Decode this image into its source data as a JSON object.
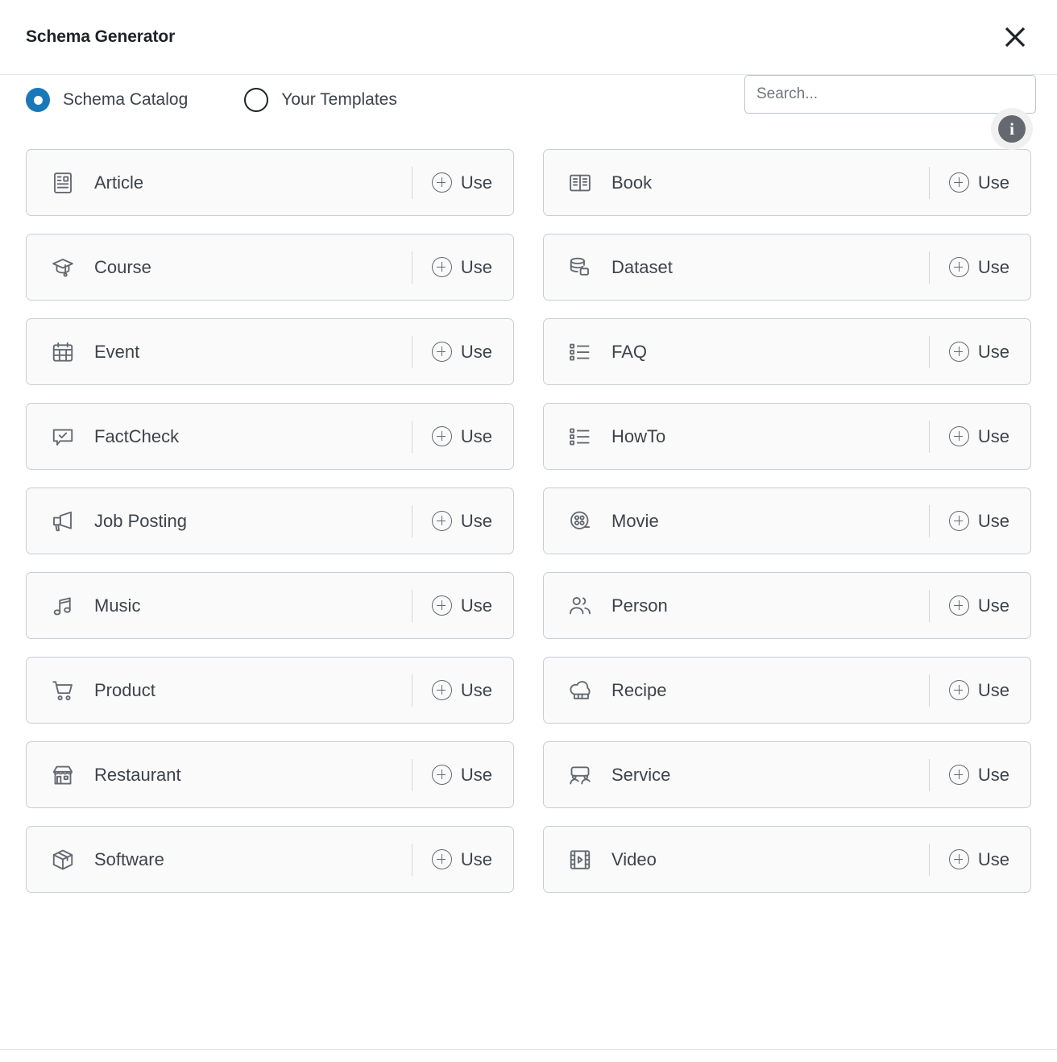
{
  "header": {
    "title": "Schema Generator",
    "close_label": "close-icon"
  },
  "toolbar": {
    "radio_options": [
      {
        "label": "Schema Catalog",
        "selected": true
      },
      {
        "label": "Your Templates",
        "selected": false
      }
    ],
    "search": {
      "placeholder": "Search...",
      "value": ""
    },
    "info_badge": {
      "glyph": "i"
    }
  },
  "catalog": {
    "use_label": "Use",
    "items": [
      {
        "label": "Article",
        "icon": "article-icon"
      },
      {
        "label": "Book",
        "icon": "book-icon"
      },
      {
        "label": "Course",
        "icon": "graduation-cap-icon"
      },
      {
        "label": "Dataset",
        "icon": "database-icon"
      },
      {
        "label": "Event",
        "icon": "calendar-icon"
      },
      {
        "label": "FAQ",
        "icon": "list-icon"
      },
      {
        "label": "FactCheck",
        "icon": "speech-bubble-check-icon"
      },
      {
        "label": "HowTo",
        "icon": "list-icon"
      },
      {
        "label": "Job Posting",
        "icon": "megaphone-icon"
      },
      {
        "label": "Movie",
        "icon": "film-reel-icon"
      },
      {
        "label": "Music",
        "icon": "music-note-icon"
      },
      {
        "label": "Person",
        "icon": "people-icon"
      },
      {
        "label": "Product",
        "icon": "shopping-cart-icon"
      },
      {
        "label": "Recipe",
        "icon": "chef-hat-icon"
      },
      {
        "label": "Restaurant",
        "icon": "storefront-icon"
      },
      {
        "label": "Service",
        "icon": "handshake-icon"
      },
      {
        "label": "Software",
        "icon": "package-box-icon"
      },
      {
        "label": "Video",
        "icon": "film-strip-play-icon"
      }
    ]
  },
  "colors": {
    "accent": "#1878b9",
    "text": "#3c434a",
    "title": "#1d2327",
    "card_bg": "#fafafa",
    "card_border": "#c9ced3"
  }
}
